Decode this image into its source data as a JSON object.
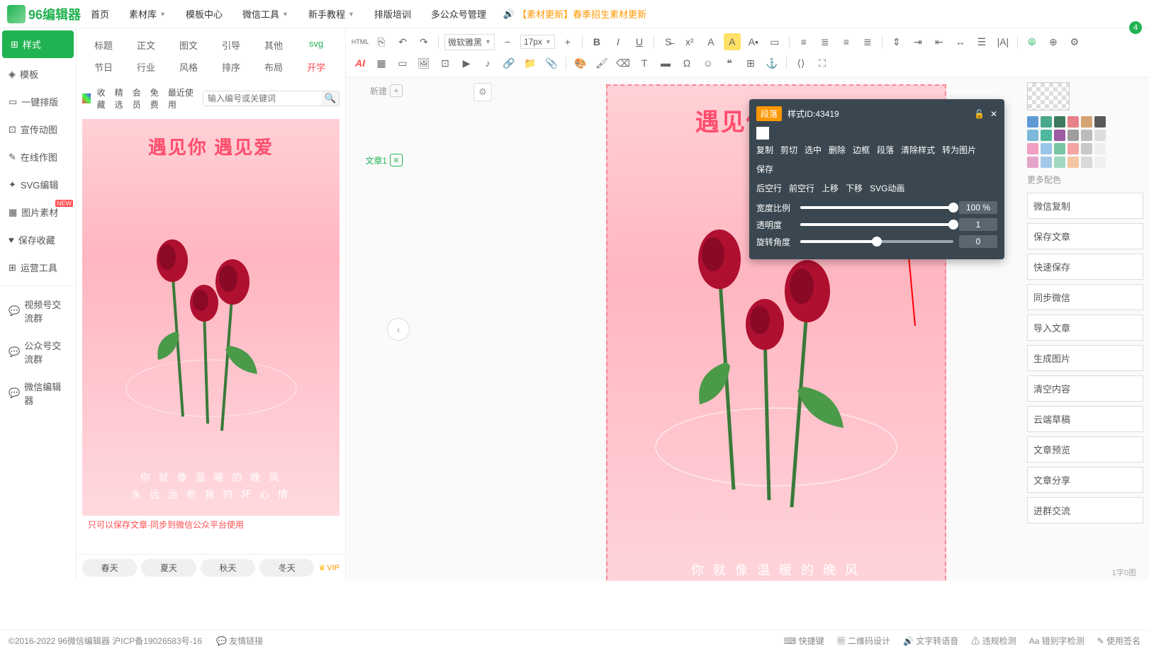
{
  "logo_text": "96编辑器",
  "top_nav": [
    "首页",
    "素材库",
    "模板中心",
    "微信工具",
    "新手教程",
    "排版培训",
    "多公众号管理"
  ],
  "announcement": "【素材更新】春季招生素材更新",
  "msg_count": "4",
  "left_sidebar": {
    "items": [
      {
        "icon": "⊞",
        "label": "样式",
        "active": true
      },
      {
        "icon": "◈",
        "label": "模板"
      },
      {
        "icon": "▭",
        "label": "一键排版"
      },
      {
        "icon": "⊡",
        "label": "宣传动图"
      },
      {
        "icon": "✎",
        "label": "在线作图"
      },
      {
        "icon": "✦",
        "label": "SVG编辑"
      },
      {
        "icon": "▦",
        "label": "图片素材",
        "badge": "NEW"
      },
      {
        "icon": "♥",
        "label": "保存收藏"
      },
      {
        "icon": "⊞",
        "label": "运营工具"
      }
    ],
    "items2": [
      {
        "icon": "💬",
        "label": "视频号交流群",
        "spk": true
      },
      {
        "icon": "💬",
        "label": "公众号交流群",
        "spk": true
      },
      {
        "icon": "💬",
        "label": "微信编辑器"
      }
    ]
  },
  "categories": {
    "row1": [
      {
        "label": "标题"
      },
      {
        "label": "正文"
      },
      {
        "label": "图文"
      },
      {
        "label": "引导"
      },
      {
        "label": "其他"
      },
      {
        "label": "svg",
        "cls": "green"
      }
    ],
    "row2": [
      {
        "label": "节日"
      },
      {
        "label": "行业"
      },
      {
        "label": "风格"
      },
      {
        "label": "排序"
      },
      {
        "label": "布局"
      },
      {
        "label": "开学",
        "cls": "red"
      }
    ]
  },
  "filters": [
    "收藏",
    "精选",
    "会员",
    "免费",
    "最近使用"
  ],
  "search_placeholder": "输入编号或关键词",
  "rose": {
    "title": "遇见你 遇见爱",
    "line1": "你 就 像 温 暖 的 晚 风",
    "line2": "永 远 治 愈 我 的 坏 心 情"
  },
  "warning": "只可以保存文章-同步到微信公众平台使用",
  "bottom_tags": [
    "春天",
    "夏天",
    "秋天",
    "冬天"
  ],
  "vip_label": "VIP",
  "canvas_tools": {
    "new": "新建",
    "article": "文章1"
  },
  "char_count": "1字0图",
  "toolbar": {
    "font": "微软雅黑",
    "size": "17px"
  },
  "right_actions": [
    "微信复制",
    "保存文章",
    "快速保存",
    "同步微信",
    "导入文章",
    "生成图片",
    "清空内容",
    "云端草稿",
    "文章预览",
    "文章分享",
    "进群交流"
  ],
  "more_colors": "更多配色",
  "float": {
    "tag": "段落",
    "id": "样式ID:43419",
    "actions1": [
      "复制",
      "剪切",
      "选中",
      "删除",
      "边框",
      "段落",
      "清除样式",
      "转为图片",
      "保存"
    ],
    "actions2": [
      "后空行",
      "前空行",
      "上移",
      "下移",
      "SVG动画"
    ],
    "sliders": [
      {
        "label": "宽度比例",
        "val": "100 %",
        "pct": 100
      },
      {
        "label": "透明度",
        "val": "1",
        "pct": 100
      },
      {
        "label": "旋转角度",
        "val": "0",
        "pct": 50
      }
    ]
  },
  "colors": [
    "#5e9ad6",
    "#4aa88c",
    "#3d7a5f",
    "#e7818a",
    "#d4a373",
    "#5a5a5a",
    "#7bb8d9",
    "#4fb89e",
    "#9c5ba3",
    "#9e9e9e",
    "#bbb",
    "#ddd",
    "#f19ec2",
    "#9bc5e8",
    "#77c7a5",
    "#f5a3a3",
    "#c9c9c9",
    "#eee",
    "#e3a5c8",
    "#a3c9e8",
    "#a0d9c0",
    "#f5c6a3",
    "#d9d9d9",
    "#f0f0f0"
  ],
  "footer": {
    "copyright": "©2016-2022 96微信编辑器 沪ICP备19026583号-16",
    "links": "友情链接",
    "tools": [
      "快捷键",
      "二维码设计",
      "文字转语音",
      "违规检测",
      "错别字检测",
      "使用签名"
    ]
  }
}
